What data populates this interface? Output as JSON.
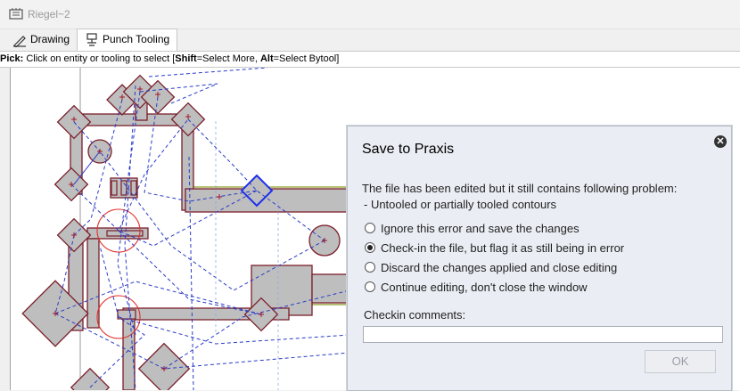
{
  "window": {
    "title": "Riegel~2"
  },
  "tabs": [
    {
      "label": "Drawing",
      "icon": "pencil-ruler-icon"
    },
    {
      "label": "Punch Tooling",
      "icon": "punch-tool-icon"
    }
  ],
  "pickbar": {
    "pick_label": "Pick:",
    "text_before_shift": " Click on entity or tooling to select [",
    "shift_key": "Shift",
    "shift_desc": "=Select More, ",
    "alt_key": "Alt",
    "alt_desc": "=Select Bytool]"
  },
  "dialog": {
    "title": "Save to Praxis",
    "message": "The file has been edited but it still contains following problem:",
    "problem": "- Untooled or partially tooled contours",
    "options": [
      {
        "label": "Ignore this error and save the changes",
        "selected": false
      },
      {
        "label": "Check-in the file, but flag it as still being in error",
        "selected": true
      },
      {
        "label": "Discard the changes applied and close editing",
        "selected": false
      },
      {
        "label": "Continue editing, don't close the window",
        "selected": false
      }
    ],
    "comments_label": "Checkin comments:",
    "comments_value": "",
    "ok_label": "OK",
    "close_icon": "close-icon"
  },
  "colors": {
    "tool_fill": "#bebebe",
    "tool_stroke": "#7a1f2b",
    "path": "#2a3cc8",
    "selected": "#1e2ff0",
    "circle_red": "#e0302a",
    "guide": "#8a9a20"
  }
}
